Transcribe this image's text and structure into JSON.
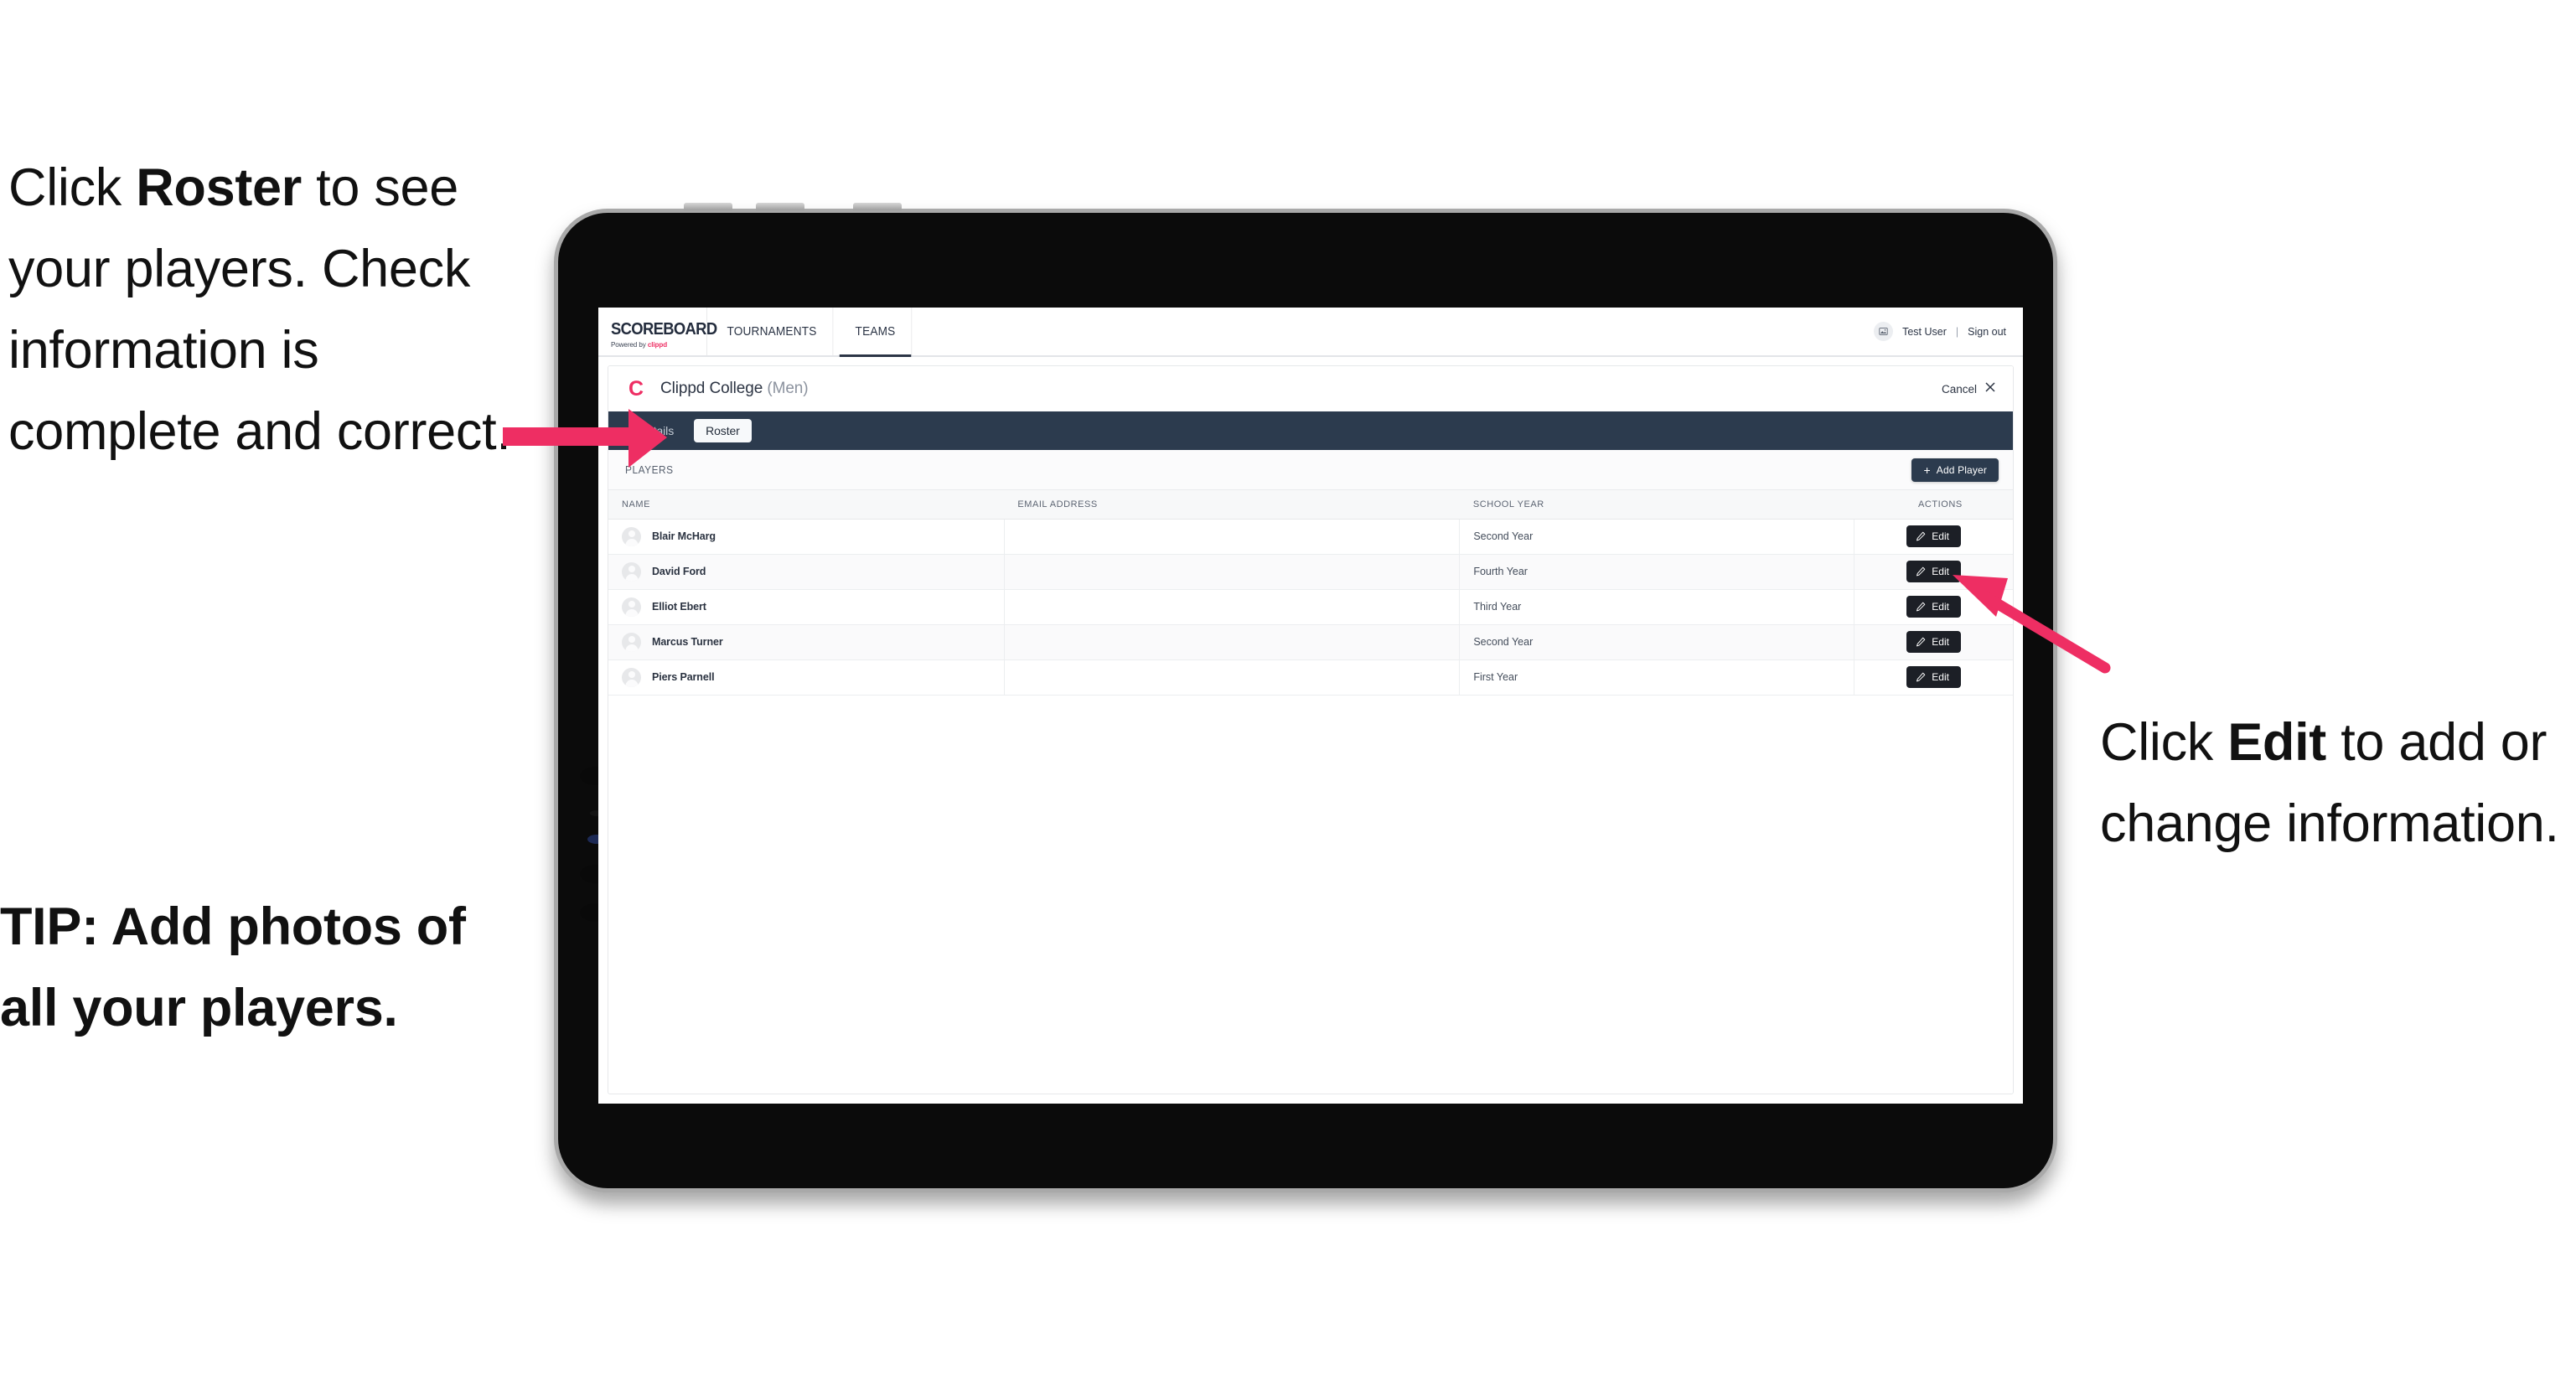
{
  "annotations": {
    "left_callout": {
      "pre": "Click ",
      "bold": "Roster",
      "post": " to see your players. Check information is complete and correct."
    },
    "tip": "TIP: Add photos of all your players.",
    "right_callout": {
      "pre": "Click ",
      "bold": "Edit",
      "post": " to add or change information."
    }
  },
  "colors": {
    "accent_pink": "#ee2e63",
    "navy": "#2c3b4e",
    "dark_button": "#1c1f26",
    "annotation_text": "#111111"
  },
  "app": {
    "logo": {
      "wordmark": "SCOREBOARD",
      "powered_by_prefix": "Powered by ",
      "powered_by_brand": "clippd"
    },
    "topnav": [
      {
        "label": "TOURNAMENTS",
        "active": false
      },
      {
        "label": "TEAMS",
        "active": true
      }
    ],
    "account": {
      "avatar_icon": "broken-image-icon",
      "username": "Test User",
      "divider": "|",
      "signout_label": "Sign out"
    }
  },
  "team_header": {
    "logo_letter": "C",
    "name": "Clippd College",
    "gender": "(Men)",
    "cancel_label": "Cancel",
    "close_icon": "close-icon"
  },
  "subtabs": [
    {
      "label": "Details",
      "active": false
    },
    {
      "label": "Roster",
      "active": true
    }
  ],
  "players_toolbar": {
    "title": "PLAYERS",
    "add_button": {
      "icon": "plus-icon",
      "label": "Add Player"
    }
  },
  "table": {
    "columns": [
      "NAME",
      "EMAIL ADDRESS",
      "SCHOOL YEAR",
      "ACTIONS"
    ],
    "rows": [
      {
        "avatar": "person-avatar-placeholder",
        "name": "Blair McHarg",
        "email": "",
        "school_year": "Second Year",
        "action_icon": "pencil-icon",
        "action_label": "Edit"
      },
      {
        "avatar": "person-avatar-placeholder",
        "name": "David Ford",
        "email": "",
        "school_year": "Fourth Year",
        "action_icon": "pencil-icon",
        "action_label": "Edit"
      },
      {
        "avatar": "person-avatar-placeholder",
        "name": "Elliot Ebert",
        "email": "",
        "school_year": "Third Year",
        "action_icon": "pencil-icon",
        "action_label": "Edit"
      },
      {
        "avatar": "person-avatar-placeholder",
        "name": "Marcus Turner",
        "email": "",
        "school_year": "Second Year",
        "action_icon": "pencil-icon",
        "action_label": "Edit"
      },
      {
        "avatar": "person-avatar-placeholder",
        "name": "Piers Parnell",
        "email": "",
        "school_year": "First Year",
        "action_icon": "pencil-icon",
        "action_label": "Edit"
      }
    ]
  }
}
